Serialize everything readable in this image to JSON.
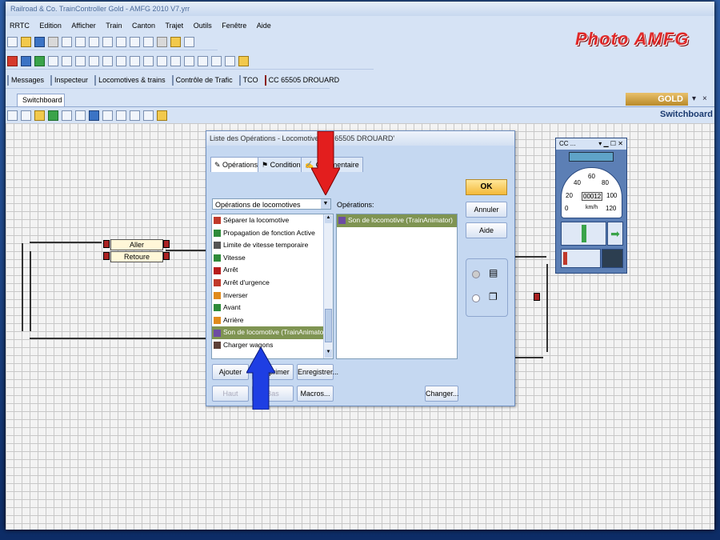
{
  "window": {
    "title": "Railroad & Co. TrainController Gold - AMFG 2010 V7.yrr"
  },
  "menu": [
    "RRTC",
    "Edition",
    "Afficher",
    "Train",
    "Canton",
    "Trajet",
    "Outils",
    "Fenêtre",
    "Aide"
  ],
  "logo_text": "Photo AMFG",
  "toolbar3": {
    "messages": "Messages",
    "inspecteur": "Inspecteur",
    "locos": "Locomotives & trains",
    "controle": "Contrôle de Trafic",
    "tco": "TCO",
    "cc": "CC 65505 DROUARD"
  },
  "doc_tab": "Switchboard",
  "gold_badge": "GOLD",
  "switchboard_title": "Switchboard",
  "blocks": [
    {
      "label": "Aller"
    },
    {
      "label": "Retoure"
    }
  ],
  "dialog": {
    "title": "Liste des Opérations - Locomotive 'CC 65505 DROUARD'",
    "tabs": [
      "Opérations",
      "Condition",
      "Commentaire"
    ],
    "combo_value": "Opérations de locomotives",
    "operations_label": "Opérations:",
    "list_items": [
      {
        "label": "Séparer la locomotive",
        "icon": "separate-icon",
        "color": "#c0392b"
      },
      {
        "label": "Propagation de fonction Active",
        "icon": "propagation-icon",
        "color": "#2e8b3a"
      },
      {
        "label": "Limite de vitesse temporaire",
        "icon": "speed-limit-icon",
        "color": "#555555"
      },
      {
        "label": "Vitesse",
        "icon": "speed-icon",
        "color": "#2e8b3a"
      },
      {
        "label": "Arrêt",
        "icon": "stop-icon",
        "color": "#b71c1c"
      },
      {
        "label": "Arrêt d'urgence",
        "icon": "emergency-stop-icon",
        "color": "#c0392b"
      },
      {
        "label": "Inverser",
        "icon": "reverse-icon",
        "color": "#e08b1d"
      },
      {
        "label": "Avant",
        "icon": "forward-icon",
        "color": "#2e8b3a"
      },
      {
        "label": "Arrière",
        "icon": "backward-icon",
        "color": "#e08b1d"
      },
      {
        "label": "Son de locomotive (TrainAnimator)",
        "icon": "sound-icon",
        "color": "#6d4ca3",
        "selected": true
      },
      {
        "label": "Charger wagons",
        "icon": "wagon-icon",
        "color": "#5d4037"
      }
    ],
    "selected_operations": [
      "Son de locomotive (TrainAnimator)"
    ],
    "buttons": {
      "ok": "OK",
      "annuler": "Annuler",
      "aide": "Aide",
      "ajouter": "Ajouter",
      "supprimer": "Supprimer",
      "enregistrer": "Enregistrer...",
      "haut": "Haut",
      "bas": "Bas",
      "macros": "Macros...",
      "changer": "Changer..."
    }
  },
  "throttle": {
    "title": "CC ...",
    "speed_display": "00012",
    "unit": "km/h",
    "scale": [
      "0",
      "20",
      "40",
      "60",
      "80",
      "100",
      "120"
    ]
  },
  "colors": {
    "accent": "#3b73c5",
    "annotation_red": "#e31e1e",
    "annotation_blue": "#1e3ee3",
    "selection": "#7f9452"
  }
}
